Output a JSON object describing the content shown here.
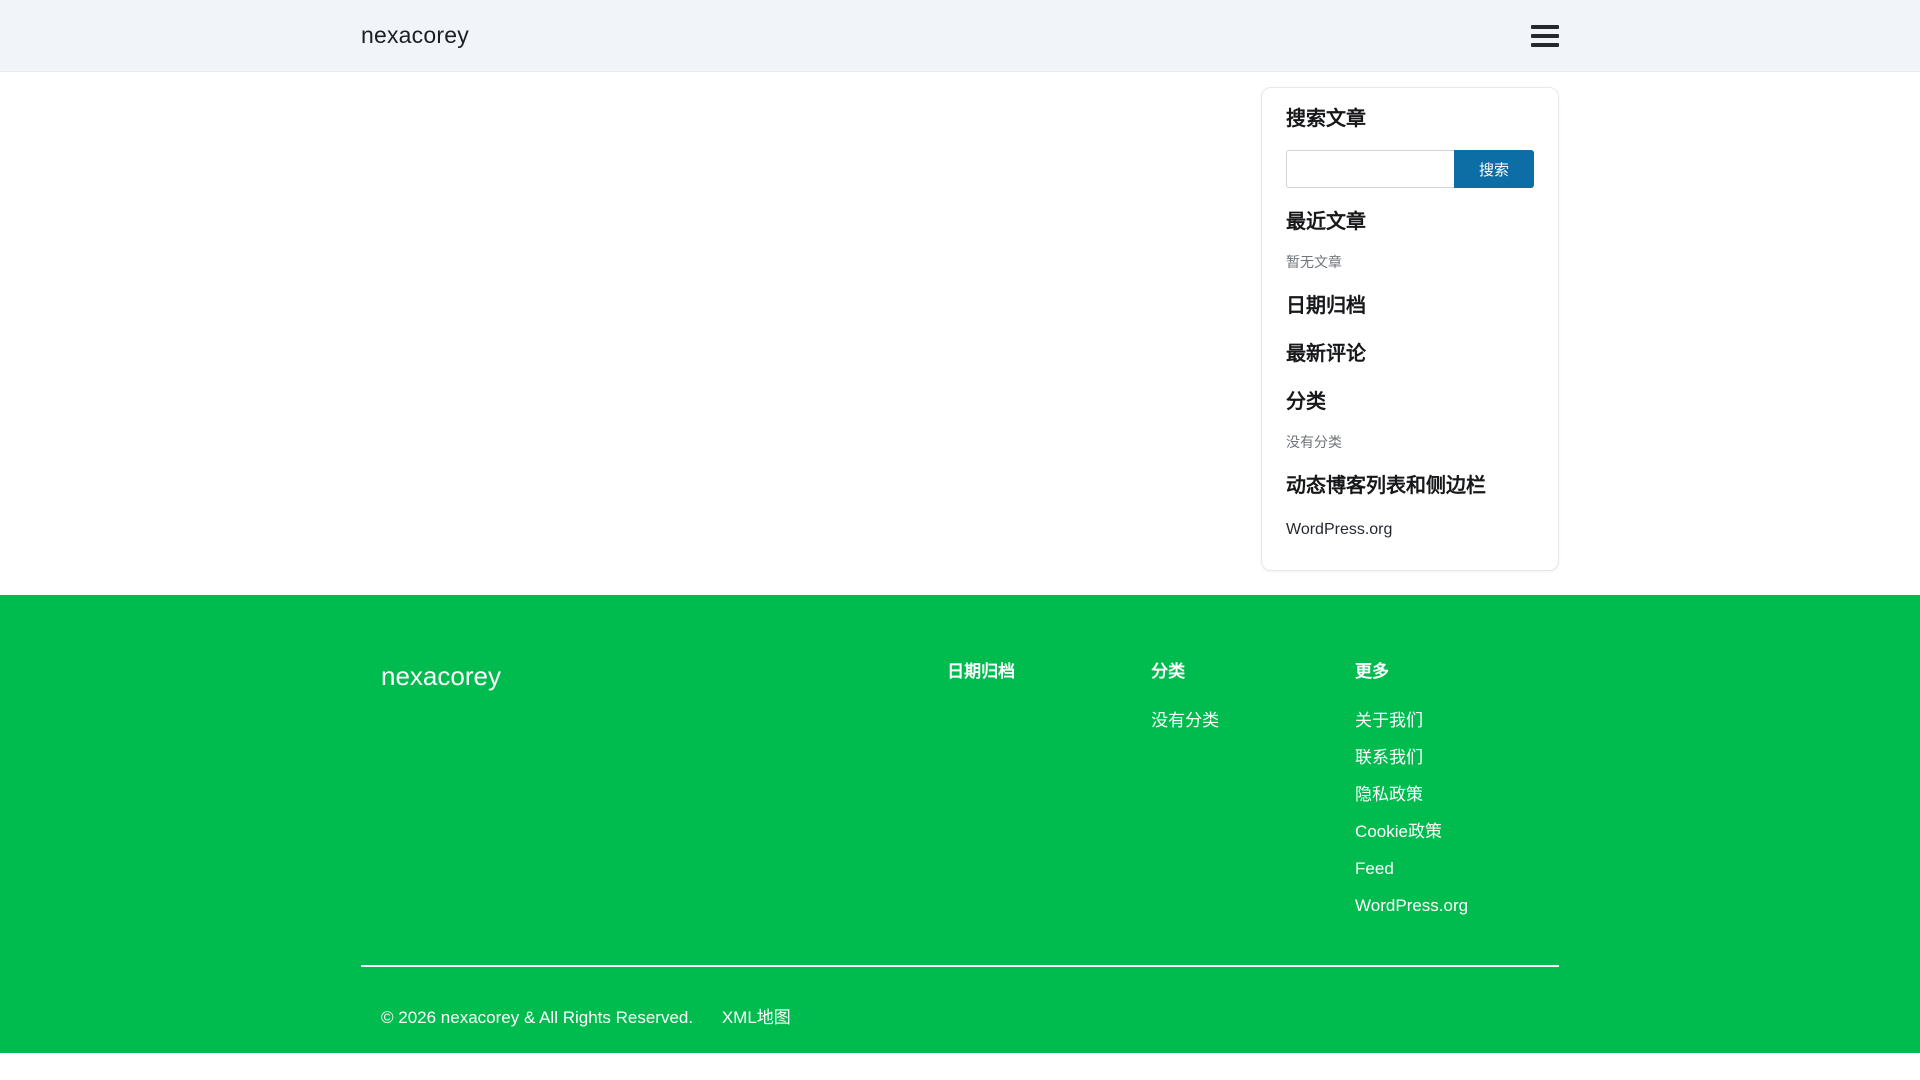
{
  "header": {
    "site_title": "nexacorey",
    "menu_icon": "hamburger-icon"
  },
  "sidebar": {
    "search": {
      "heading": "搜索文章",
      "value": "",
      "button_label": "搜索"
    },
    "recent_posts": {
      "heading": "最近文章",
      "empty_text": "暂无文章"
    },
    "archives": {
      "heading": "日期归档"
    },
    "comments": {
      "heading": "最新评论"
    },
    "categories": {
      "heading": "分类",
      "empty_text": "没有分类"
    },
    "meta": {
      "heading": "动态博客列表和侧边栏",
      "links": [
        "WordPress.org"
      ]
    }
  },
  "footer": {
    "brand": "nexacorey",
    "columns": [
      {
        "heading": "日期归档",
        "links": []
      },
      {
        "heading": "分类",
        "links": [
          "没有分类"
        ]
      },
      {
        "heading": "更多",
        "links": [
          "关于我们",
          "联系我们",
          "隐私政策",
          "Cookie政策",
          "Feed",
          "WordPress.org"
        ]
      }
    ],
    "copyright": "© 2026 nexacorey & All Rights Reserved.",
    "sitemap_link": "XML地图"
  },
  "colors": {
    "header_bg": "#f1f5f9",
    "accent_green": "#00bc4e",
    "search_button_blue": "#0d6ea5",
    "heading_text": "#17181a",
    "muted_text": "#70757c"
  }
}
